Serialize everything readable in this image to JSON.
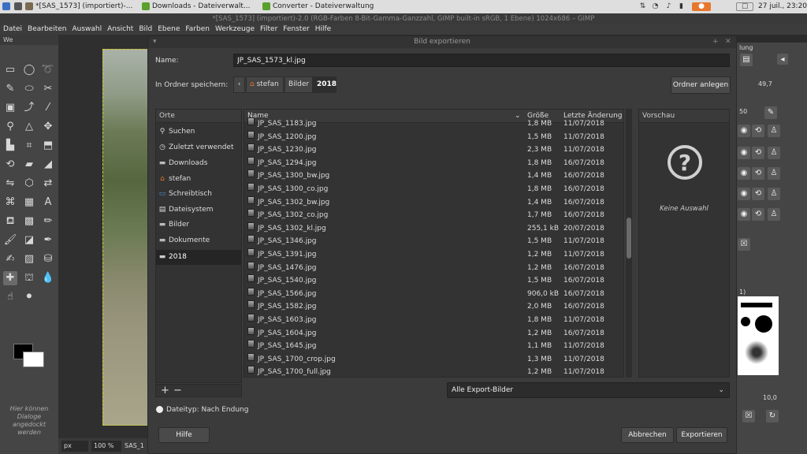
{
  "taskbar": {
    "tasks": [
      "*[SAS_1573] (importiert)-...",
      "Downloads - Dateiverwalt...",
      "Converter - Dateiverwaltung"
    ],
    "clock": "27 juil., 23:20"
  },
  "gimp": {
    "title": "*[SAS_1573] (importiert)-2.0 (RGB-Farben 8-Bit-Gamma-Ganzzahl, GIMP built-in sRGB, 1 Ebene) 1024x686 – GIMP",
    "menu": [
      "Datei",
      "Bearbeiten",
      "Auswahl",
      "Ansicht",
      "Bild",
      "Ebene",
      "Farben",
      "Werkzeuge",
      "Filter",
      "Fenster",
      "Hilfe"
    ],
    "toolbox_title": "We",
    "dock_hint": "Hier können Dialoge angedockt werden",
    "status_unit": "px",
    "status_zoom": "100 %",
    "status_name": "SAS_1",
    "right_dock": {
      "tab_partial": "lung",
      "value1": "49,7",
      "value2": "50",
      "brush_hint": "1)",
      "spacing_value": "10,0"
    }
  },
  "dialog": {
    "title": "Bild exportieren",
    "name_label": "Name:",
    "filename": "JP_SAS_1573_kl.jpg",
    "folder_label": "In Ordner speichern:",
    "breadcrumbs": [
      "stefan",
      "Bilder",
      "2018"
    ],
    "create_folder": "Ordner anlegen",
    "places_header": "Orte",
    "places": [
      {
        "label": "Suchen",
        "icon": "search-icon"
      },
      {
        "label": "Zuletzt verwendet",
        "icon": "recent-icon"
      },
      {
        "label": "Downloads",
        "icon": "folder-icon"
      },
      {
        "label": "stefan",
        "icon": "home-icon"
      },
      {
        "label": "Schreibtisch",
        "icon": "desktop-icon"
      },
      {
        "label": "Dateisystem",
        "icon": "drive-icon"
      },
      {
        "label": "Bilder",
        "icon": "folder-icon"
      },
      {
        "label": "Dokumente",
        "icon": "folder-icon"
      },
      {
        "label": "2018",
        "icon": "folder-icon"
      }
    ],
    "columns": {
      "name": "Name",
      "size": "Größe",
      "modified": "Letzte Änderung"
    },
    "files": [
      {
        "name": "JP_SAS_1183.jpg",
        "size": "1,8 MB",
        "date": "11/07/2018"
      },
      {
        "name": "JP_SAS_1200.jpg",
        "size": "1,5 MB",
        "date": "11/07/2018"
      },
      {
        "name": "JP_SAS_1230.jpg",
        "size": "2,3 MB",
        "date": "11/07/2018"
      },
      {
        "name": "JP_SAS_1294.jpg",
        "size": "1,8 MB",
        "date": "16/07/2018"
      },
      {
        "name": "JP_SAS_1300_bw.jpg",
        "size": "1,4 MB",
        "date": "16/07/2018"
      },
      {
        "name": "JP_SAS_1300_co.jpg",
        "size": "1,8 MB",
        "date": "16/07/2018"
      },
      {
        "name": "JP_SAS_1302_bw.jpg",
        "size": "1,4 MB",
        "date": "16/07/2018"
      },
      {
        "name": "JP_SAS_1302_co.jpg",
        "size": "1,7 MB",
        "date": "16/07/2018"
      },
      {
        "name": "JP_SAS_1302_kl.jpg",
        "size": "255,1 kB",
        "date": "20/07/2018"
      },
      {
        "name": "JP_SAS_1346.jpg",
        "size": "1,5 MB",
        "date": "11/07/2018"
      },
      {
        "name": "JP_SAS_1391.jpg",
        "size": "1,2 MB",
        "date": "11/07/2018"
      },
      {
        "name": "JP_SAS_1476.jpg",
        "size": "1,2 MB",
        "date": "16/07/2018"
      },
      {
        "name": "JP_SAS_1540.jpg",
        "size": "1,5 MB",
        "date": "16/07/2018"
      },
      {
        "name": "JP_SAS_1566.jpg",
        "size": "906,0 kB",
        "date": "16/07/2018"
      },
      {
        "name": "JP_SAS_1582.jpg",
        "size": "2,0 MB",
        "date": "16/07/2018"
      },
      {
        "name": "JP_SAS_1603.jpg",
        "size": "1,8 MB",
        "date": "11/07/2018"
      },
      {
        "name": "JP_SAS_1604.jpg",
        "size": "1,2 MB",
        "date": "16/07/2018"
      },
      {
        "name": "JP_SAS_1645.jpg",
        "size": "1,1 MB",
        "date": "11/07/2018"
      },
      {
        "name": "JP_SAS_1700_crop.jpg",
        "size": "1,3 MB",
        "date": "11/07/2018"
      },
      {
        "name": "JP_SAS_1700_full.jpg",
        "size": "1,2 MB",
        "date": "11/07/2018"
      }
    ],
    "preview_header": "Vorschau",
    "preview_empty": "Keine Auswahl",
    "filter": "Alle Export-Bilder",
    "filetype_label": "Dateityp: Nach Endung",
    "help": "Hilfe",
    "cancel": "Abbrechen",
    "export": "Exportieren"
  }
}
